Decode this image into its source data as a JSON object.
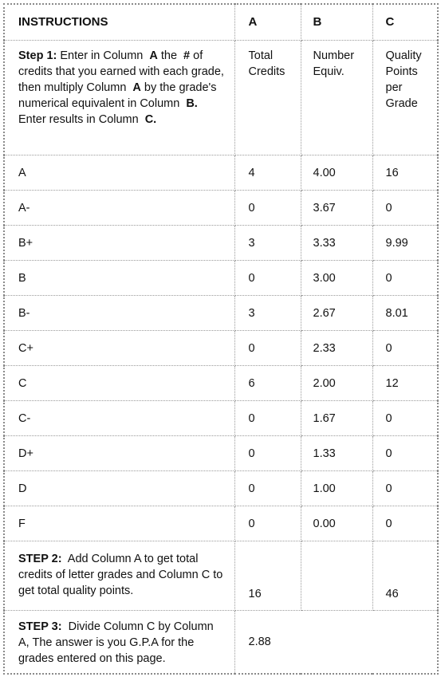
{
  "header": {
    "instructions": "INSTRUCTIONS",
    "col_a": "A",
    "col_b": "B",
    "col_c": "C"
  },
  "step1": {
    "label": "Step 1:",
    "text_1": "Enter in Column",
    "col_a_1": "A",
    "text_2": "the",
    "hash": "#",
    "text_3": "of credits that you earned with each grade, then multiply Column",
    "col_a_2": "A",
    "text_4": "by the grade's numerical equivalent in Column",
    "col_b": "B.",
    "text_5": "Enter results in Column",
    "col_c": "C.",
    "col_a_desc": "Total Credits",
    "col_b_desc": "Number Equiv.",
    "col_c_desc": "Quality Points per Grade"
  },
  "grades": [
    {
      "grade": "A",
      "credits": "4",
      "equiv": "4.00",
      "points": "16"
    },
    {
      "grade": "A-",
      "credits": "0",
      "equiv": "3.67",
      "points": "0"
    },
    {
      "grade": "B+",
      "credits": "3",
      "equiv": "3.33",
      "points": "9.99"
    },
    {
      "grade": "B",
      "credits": "0",
      "equiv": "3.00",
      "points": "0"
    },
    {
      "grade": "B-",
      "credits": "3",
      "equiv": "2.67",
      "points": "8.01"
    },
    {
      "grade": "C+",
      "credits": "0",
      "equiv": "2.33",
      "points": "0"
    },
    {
      "grade": "C",
      "credits": "6",
      "equiv": "2.00",
      "points": "12"
    },
    {
      "grade": "C-",
      "credits": "0",
      "equiv": "1.67",
      "points": "0"
    },
    {
      "grade": "D+",
      "credits": "0",
      "equiv": "1.33",
      "points": "0"
    },
    {
      "grade": "D",
      "credits": "0",
      "equiv": "1.00",
      "points": "0"
    },
    {
      "grade": "F",
      "credits": "0",
      "equiv": "0.00",
      "points": "0"
    }
  ],
  "step2": {
    "label": "STEP 2:",
    "text": "Add Column A to get total credits of letter grades and Column C to get total quality points.",
    "total_credits": "16",
    "total_points": "46"
  },
  "step3": {
    "label": "STEP 3:",
    "text": "Divide Column C by Column A, The answer is you G.P.A for the grades entered on this page.",
    "gpa": "2.88"
  }
}
